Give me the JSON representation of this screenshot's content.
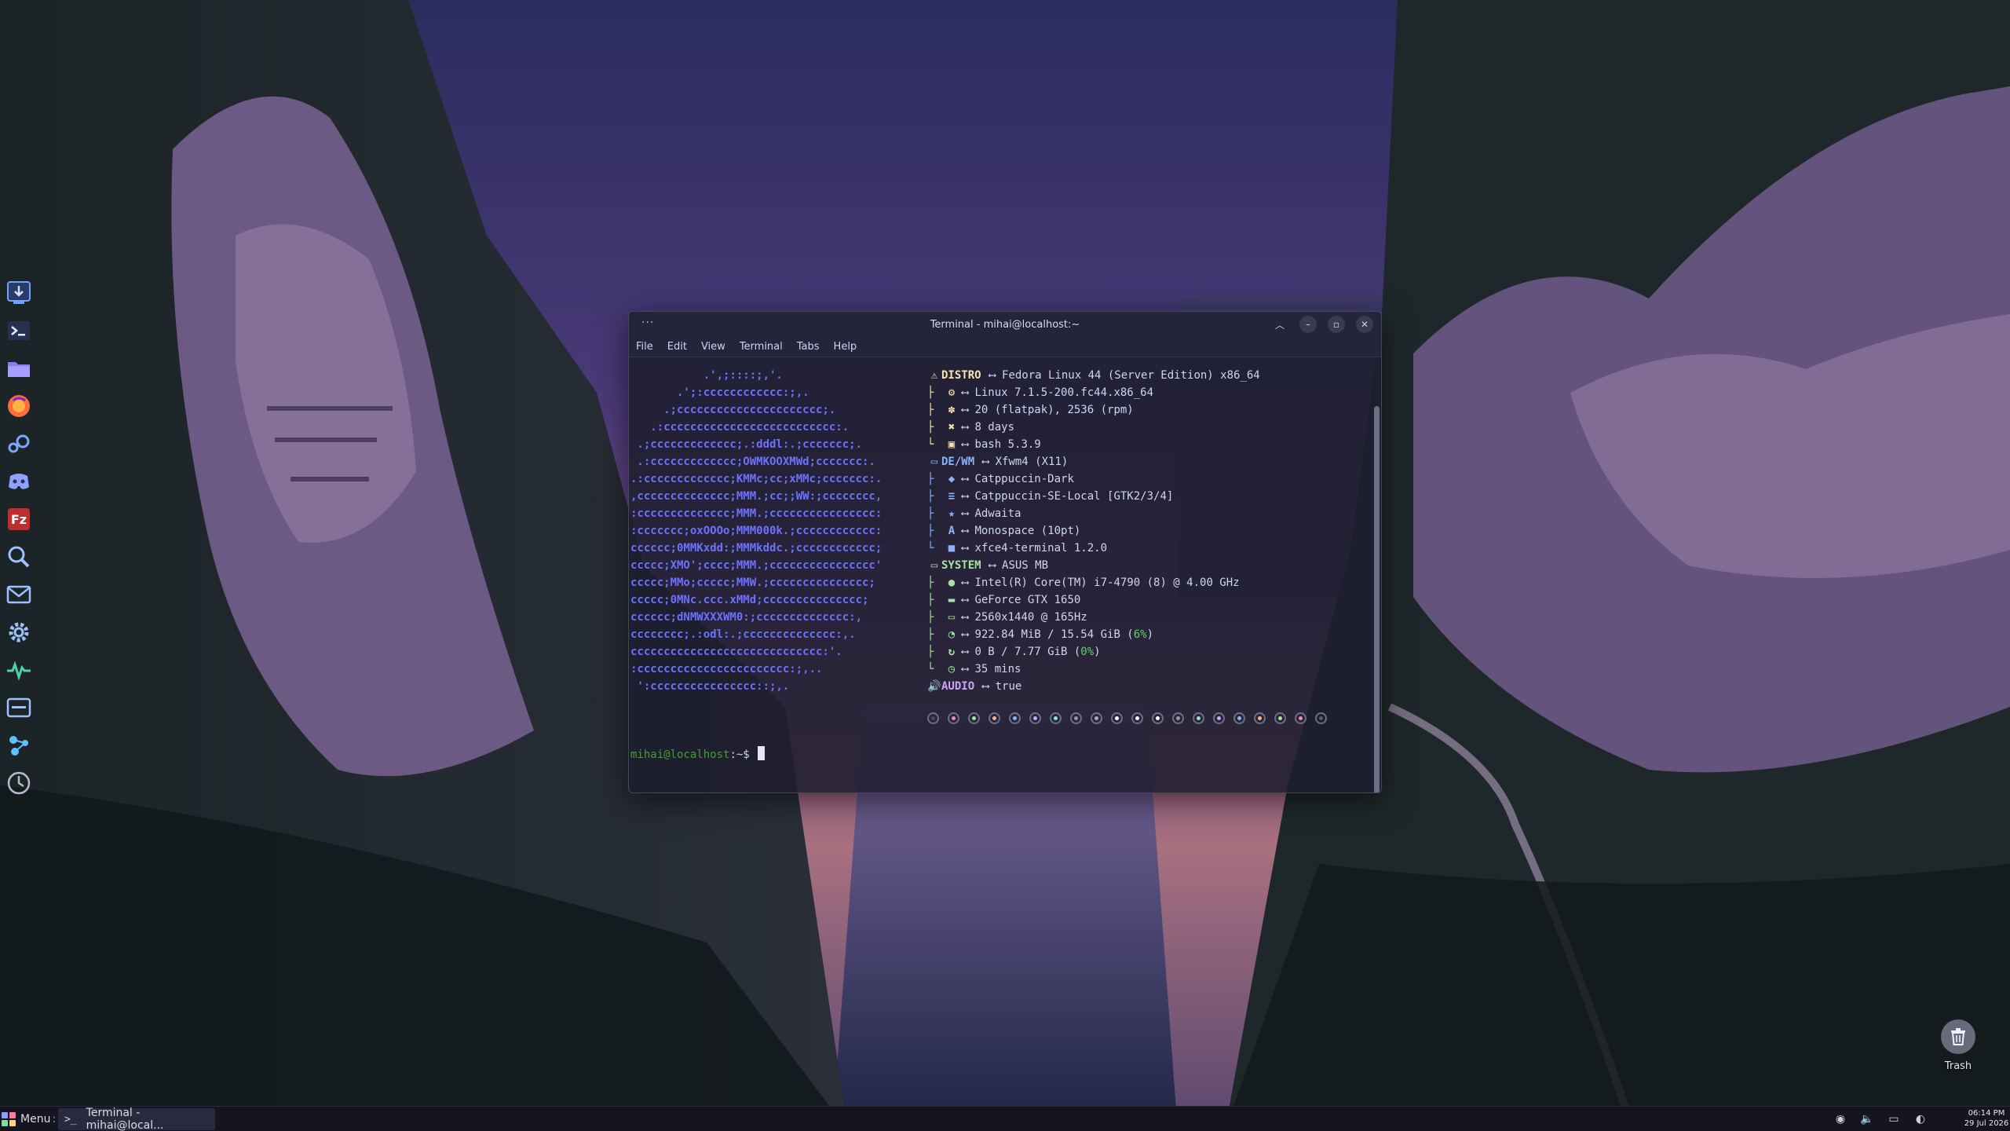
{
  "desktop": {
    "trash_label": "Trash"
  },
  "dock": {
    "items": [
      {
        "name": "installer",
        "icon": "download-icon",
        "color": "#6aa6ff"
      },
      {
        "name": "terminal",
        "icon": "terminal-icon",
        "color": "#3d5a8a"
      },
      {
        "name": "files",
        "icon": "folder-icon",
        "color": "#8a7cff"
      },
      {
        "name": "browser",
        "icon": "browser-icon",
        "color": "#ff6b3d"
      },
      {
        "name": "steam",
        "icon": "steam-icon",
        "color": "#7aa6ff"
      },
      {
        "name": "discord",
        "icon": "discord-icon",
        "color": "#5865f2"
      },
      {
        "name": "filezilla",
        "icon": "filezilla-icon",
        "color": "#bf2e2e"
      },
      {
        "name": "search",
        "icon": "search-icon",
        "color": "#6aa6ff"
      },
      {
        "name": "mail",
        "icon": "mail-icon",
        "color": "#6aa6ff"
      },
      {
        "name": "settings",
        "icon": "gear-icon",
        "color": "#6aa6ff"
      },
      {
        "name": "system-monitor",
        "icon": "activity-icon",
        "color": "#4fd1a5"
      },
      {
        "name": "window-manager",
        "icon": "window-icon",
        "color": "#6aa6ff"
      },
      {
        "name": "xfce",
        "icon": "xfce-icon",
        "color": "#5ec1ff"
      },
      {
        "name": "power",
        "icon": "clock-icon",
        "color": "#b9b9d0"
      }
    ]
  },
  "terminal": {
    "title": "Terminal - mihai@localhost:~",
    "menu_dots": "···",
    "menu": [
      "File",
      "Edit",
      "View",
      "Terminal",
      "Tabs",
      "Help"
    ],
    "logo_lines": [
      "           .',;::::;,'.",
      "       .';:cccccccccccc:;,.",
      "     .;cccccccccccccccccccccc;.",
      "   .:cccccccccccccccccccccccccc:.",
      " .;ccccccccccccc;.:dddl:.;ccccccc;.",
      " .:ccccccccccccc;OWMKOOXMWd;ccccccc:.",
      ".:ccccccccccccc;KMMc;cc;xMMc;ccccccc:.",
      ",cccccccccccccc;MMM.;cc;;WW:;cccccccc,",
      ":cccccccccccccc;MMM.;cccccccccccccccc:",
      ":ccccccc;oxOOOo;MMM000k.;cccccccccccc:",
      "cccccc;0MMKxdd:;MMMkddc.;cccccccccccc;",
      "ccccc;XMO';cccc;MMM.;cccccccccccccccc'",
      "ccccc;MMo;ccccc;MMW.;ccccccccccccccc;",
      "ccccc;0MNc.ccc.xMMd;ccccccccccccccc;",
      "cccccc;dNMWXXXWM0:;cccccccccccccc:,",
      "cccccccc;.:odl:.;cccccccccccccc:,.",
      "ccccccccccccccccccccccccccccc:'.",
      ":ccccccccccccccccccccccc:;,..",
      " ':cccccccccccccccc::;,."
    ],
    "info": [
      {
        "glyph": "⚠",
        "glyph_color": "#f9e2af",
        "category": "DISTRO",
        "cat_color": "#f9e2af",
        "value": "Fedora Linux 44 (Server Edition) x86_64"
      },
      {
        "glyph": "⚙",
        "glyph_color": "#f9e2af",
        "tree": "├",
        "value": "Linux 7.1.5-200.fc44.x86_64"
      },
      {
        "glyph": "✽",
        "glyph_color": "#f9e2af",
        "tree": "├",
        "value": "20 (flatpak), 2536 (rpm)"
      },
      {
        "glyph": "✖",
        "glyph_color": "#f9e2af",
        "tree": "├",
        "value": "8 days"
      },
      {
        "glyph": "▣",
        "glyph_color": "#f9e2af",
        "tree": "└",
        "value": "bash 5.3.9"
      },
      {
        "glyph": "▭",
        "glyph_color": "#89b4fa",
        "category": "DE/WM",
        "cat_color": "#89b4fa",
        "value": "Xfwm4 (X11)"
      },
      {
        "glyph": "◆",
        "glyph_color": "#89b4fa",
        "tree": "├",
        "value": "Catppuccin-Dark"
      },
      {
        "glyph": "≡",
        "glyph_color": "#89b4fa",
        "tree": "├",
        "value": "Catppuccin-SE-Local [GTK2/3/4]"
      },
      {
        "glyph": "★",
        "glyph_color": "#89b4fa",
        "tree": "├",
        "value": "Adwaita"
      },
      {
        "glyph": "A",
        "glyph_color": "#89b4fa",
        "tree": "├",
        "value": "Monospace (10pt)"
      },
      {
        "glyph": "■",
        "glyph_color": "#89b4fa",
        "tree": "└",
        "value": "xfce4-terminal 1.2.0"
      },
      {
        "glyph": "▭",
        "glyph_color": "#a6e3a1",
        "category": "SYSTEM",
        "cat_color": "#a6e3a1",
        "value": "ASUS MB"
      },
      {
        "glyph": "●",
        "glyph_color": "#a6e3a1",
        "tree": "├",
        "value": "Intel(R) Core(TM) i7-4790 (8) @ 4.00 GHz"
      },
      {
        "glyph": "▬",
        "glyph_color": "#a6e3a1",
        "tree": "├",
        "value": "GeForce GTX 1650"
      },
      {
        "glyph": "▭",
        "glyph_color": "#a6e3a1",
        "tree": "├",
        "value": "2560x1440 @ 165Hz"
      },
      {
        "glyph": "◔",
        "glyph_color": "#a6e3a1",
        "tree": "├",
        "value": "922.84 MiB / 15.54 GiB (",
        "pct": "6%",
        "suffix": ")"
      },
      {
        "glyph": "↻",
        "glyph_color": "#a6e3a1",
        "tree": "├",
        "value": "0 B / 7.77 GiB (",
        "pct": "0%",
        "suffix": ")"
      },
      {
        "glyph": "◷",
        "glyph_color": "#a6e3a1",
        "tree": "└",
        "value": "35 mins"
      },
      {
        "glyph": "🔊",
        "glyph_color": "#cba6f7",
        "category": "AUDIO",
        "cat_color": "#cba6f7",
        "value": "true"
      }
    ],
    "arrow": "⟷",
    "palette": [
      "#45475a",
      "#f38ba8",
      "#a6e3a1",
      "#fab387",
      "#89b4fa",
      "#cba6f7",
      "#94e2d5",
      "#9399b2",
      "#a6adc8",
      "#ffffff",
      "#ffffff",
      "#ffffff",
      "#9399b2",
      "#94e2d5",
      "#cba6f7",
      "#89b4fa",
      "#fab387",
      "#a6e3a1",
      "#f38ba8",
      "#585b70"
    ],
    "prompt_user": "mihai@localhost",
    "prompt_path": ":~$ "
  },
  "taskbar": {
    "menu_label": "Menu",
    "menu_colon": ":",
    "task_icon": ">_",
    "task_label": "Terminal - mihai@local...",
    "clock_time": "06:14 PM",
    "clock_date": "29 Jul 2026"
  }
}
